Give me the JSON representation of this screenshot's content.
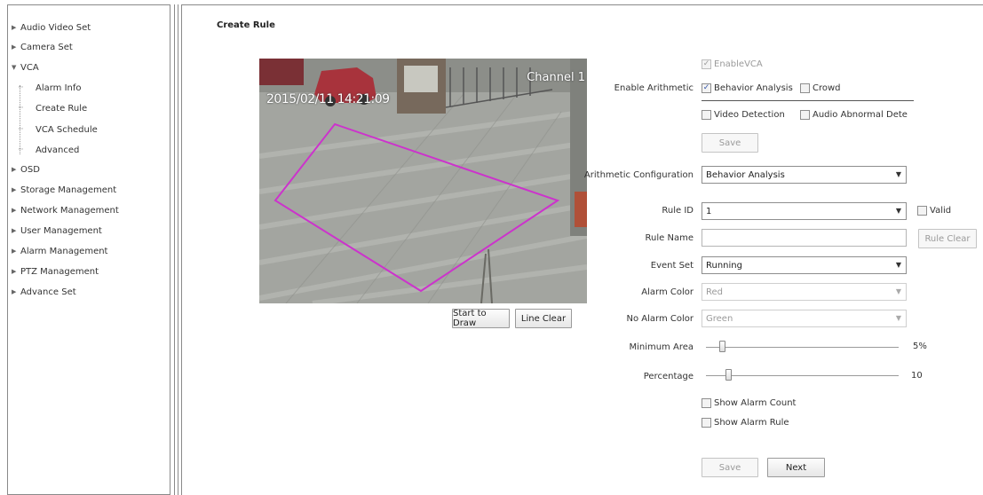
{
  "sidebar": {
    "items": [
      {
        "label": "Audio Video Set",
        "arrow": "▶"
      },
      {
        "label": "Camera Set",
        "arrow": "▶"
      },
      {
        "label": "VCA",
        "arrow": "▼"
      },
      {
        "label": "OSD",
        "arrow": "▶"
      },
      {
        "label": "Storage Management",
        "arrow": "▶"
      },
      {
        "label": "Network Management",
        "arrow": "▶"
      },
      {
        "label": "User Management",
        "arrow": "▶"
      },
      {
        "label": "Alarm Management",
        "arrow": "▶"
      },
      {
        "label": "PTZ Management",
        "arrow": "▶"
      },
      {
        "label": "Advance Set",
        "arrow": "▶"
      }
    ],
    "vca_children": [
      {
        "label": "Alarm Info"
      },
      {
        "label": "Create Rule"
      },
      {
        "label": "VCA Schedule"
      },
      {
        "label": "Advanced"
      }
    ]
  },
  "page": {
    "title": "Create Rule"
  },
  "video": {
    "timestamp": "2015/02/11 14:21:09",
    "channel": "Channel 1",
    "region_color": "#cc33cc"
  },
  "video_buttons": {
    "start_draw": "Start to Draw",
    "line_clear": "Line Clear"
  },
  "form": {
    "enable_vca": {
      "label": "EnableVCA",
      "checked": true
    },
    "enable_arithmetic_label": "Enable Arithmetic",
    "behavior_analysis": {
      "label": "Behavior Analysis",
      "checked": true
    },
    "crowd": {
      "label": "Crowd",
      "checked": false
    },
    "video_detection": {
      "label": "Video Detection",
      "checked": false
    },
    "audio_abnormal": {
      "label": "Audio Abnormal Dete",
      "checked": false
    },
    "save_top": "Save",
    "arith_config_label": "Arithmetic Configuration",
    "arith_config_value": "Behavior Analysis",
    "rule_id_label": "Rule ID",
    "rule_id_value": "1",
    "valid_label": "Valid",
    "rule_name_label": "Rule Name",
    "rule_name_value": "",
    "rule_clear": "Rule Clear",
    "event_set_label": "Event Set",
    "event_set_value": "Running",
    "alarm_color_label": "Alarm Color",
    "alarm_color_value": "Red",
    "no_alarm_color_label": "No Alarm Color",
    "no_alarm_color_value": "Green",
    "min_area_label": "Minimum Area",
    "min_area_value": "5%",
    "min_area_fraction": 0.05,
    "percentage_label": "Percentage",
    "percentage_value": "10",
    "percentage_fraction": 0.1,
    "show_alarm_count": "Show Alarm Count",
    "show_alarm_rule": "Show Alarm Rule",
    "save_bottom": "Save",
    "next": "Next"
  }
}
